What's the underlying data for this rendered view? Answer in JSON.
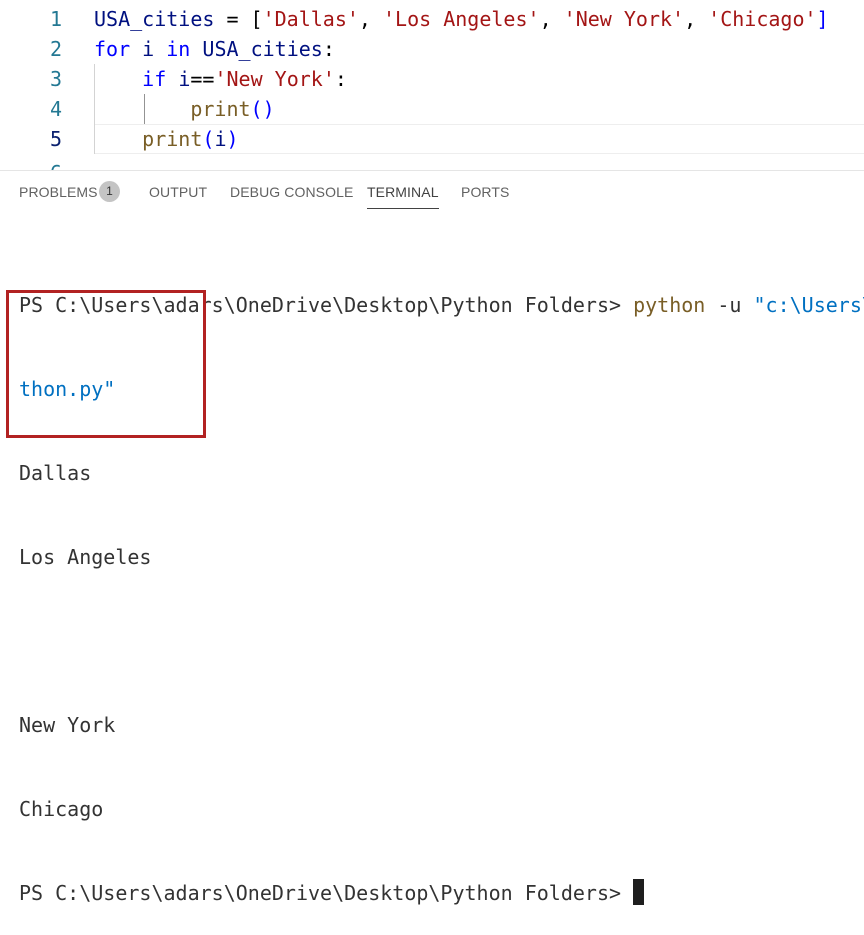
{
  "editor": {
    "lines": [
      {
        "num": "1",
        "tokens": [
          {
            "t": "USA_cities",
            "c": "var"
          },
          {
            "t": " = ",
            "c": "op"
          },
          {
            "t": "[",
            "c": "op"
          },
          {
            "t": "'Dallas'",
            "c": "str"
          },
          {
            "t": ", ",
            "c": "op"
          },
          {
            "t": "'Los Angeles'",
            "c": "str"
          },
          {
            "t": ", ",
            "c": "op"
          },
          {
            "t": "'New York'",
            "c": "str"
          },
          {
            "t": ", ",
            "c": "op"
          },
          {
            "t": "'Chicago'",
            "c": "str"
          },
          {
            "t": "]",
            "c": "kw"
          }
        ]
      },
      {
        "num": "2",
        "tokens": [
          {
            "t": "for",
            "c": "kw"
          },
          {
            "t": " ",
            "c": "op"
          },
          {
            "t": "i",
            "c": "var"
          },
          {
            "t": " ",
            "c": "op"
          },
          {
            "t": "in",
            "c": "kw"
          },
          {
            "t": " ",
            "c": "op"
          },
          {
            "t": "USA_cities",
            "c": "var"
          },
          {
            "t": ":",
            "c": "op"
          }
        ]
      },
      {
        "num": "3",
        "tokens": [
          {
            "t": "    ",
            "c": "op"
          },
          {
            "t": "if",
            "c": "kw"
          },
          {
            "t": " ",
            "c": "op"
          },
          {
            "t": "i",
            "c": "var"
          },
          {
            "t": "==",
            "c": "op"
          },
          {
            "t": "'New York'",
            "c": "str"
          },
          {
            "t": ":",
            "c": "op"
          }
        ]
      },
      {
        "num": "4",
        "tokens": [
          {
            "t": "        ",
            "c": "op"
          },
          {
            "t": "print",
            "c": "fn"
          },
          {
            "t": "()",
            "c": "kw"
          }
        ]
      },
      {
        "num": "5",
        "tokens": [
          {
            "t": "    ",
            "c": "op"
          },
          {
            "t": "print",
            "c": "fn"
          },
          {
            "t": "(",
            "c": "kw"
          },
          {
            "t": "i",
            "c": "var"
          },
          {
            "t": ")",
            "c": "kw"
          }
        ]
      }
    ],
    "partial_line_num": "6"
  },
  "panel": {
    "tabs": [
      {
        "label": "PROBLEMS",
        "active": false
      },
      {
        "label": "OUTPUT",
        "active": false
      },
      {
        "label": "DEBUG CONSOLE",
        "active": false
      },
      {
        "label": "TERMINAL",
        "active": true
      },
      {
        "label": "PORTS",
        "active": false
      }
    ],
    "problems_count": "1"
  },
  "terminal": {
    "prompt": "PS C:\\Users\\adars\\OneDrive\\Desktop\\Python Folders> ",
    "command": "python",
    "flag": " -u ",
    "path_start": "\"c:\\Users\\",
    "path_end": "thon.py\"",
    "output": [
      "Dallas",
      "Los Angeles",
      "",
      "New York",
      "Chicago"
    ],
    "final_prompt": "PS C:\\Users\\adars\\OneDrive\\Desktop\\Python Folders> "
  }
}
